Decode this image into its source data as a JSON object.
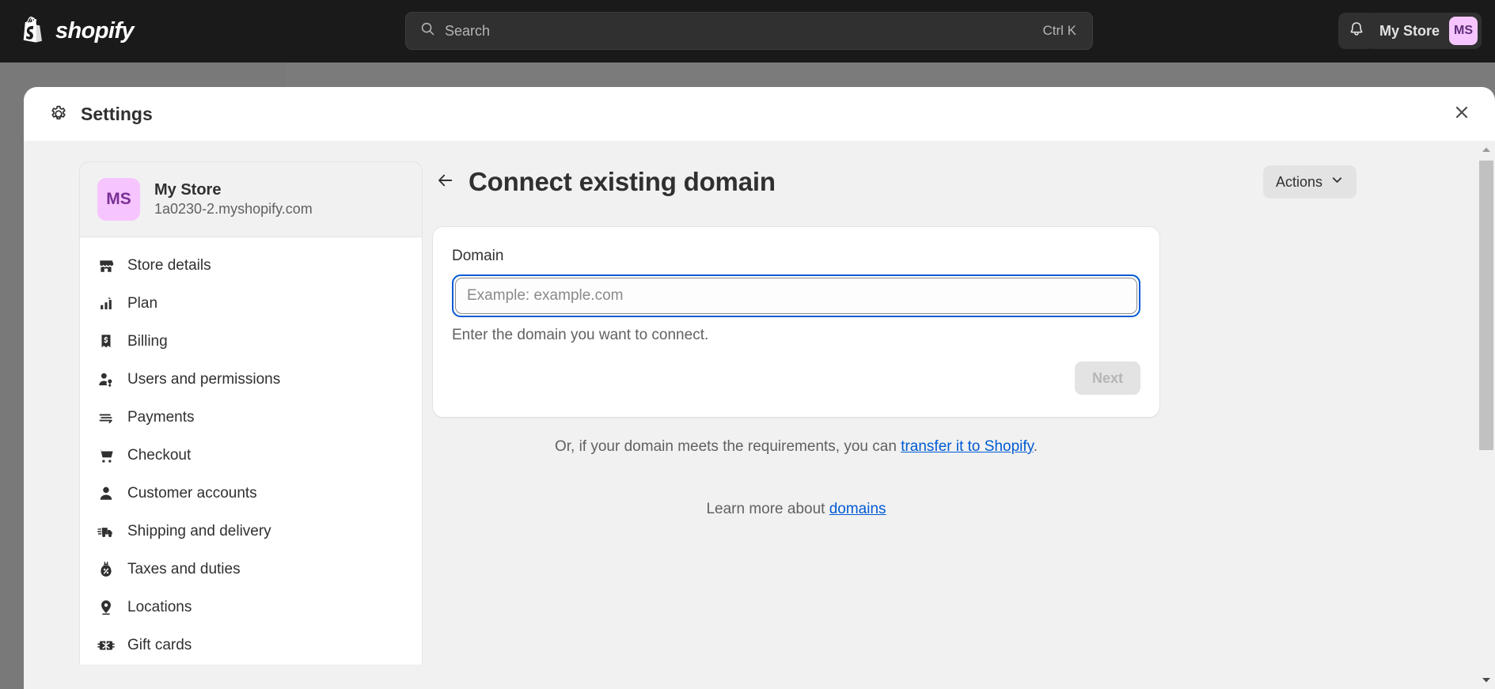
{
  "topbar": {
    "logo_text": "shopify",
    "logo_icon": "shopify-bag-icon",
    "search": {
      "icon": "search-icon",
      "placeholder": "Search",
      "value": "",
      "shortcut": "Ctrl K"
    },
    "notifications_icon": "bell-icon",
    "store_chip": {
      "name": "My Store",
      "initials": "MS",
      "avatar_color": "#f6c5ff"
    }
  },
  "modal": {
    "icon": "gear-icon",
    "title": "Settings",
    "close_icon": "close-icon"
  },
  "sidebar": {
    "store_card": {
      "initials": "MS",
      "name": "My Store",
      "url": "1a0230-2.myshopify.com"
    },
    "items": [
      {
        "label": "Store details",
        "icon": "store-icon"
      },
      {
        "label": "Plan",
        "icon": "plan-chart-icon"
      },
      {
        "label": "Billing",
        "icon": "billing-receipt-icon"
      },
      {
        "label": "Users and permissions",
        "icon": "users-key-icon"
      },
      {
        "label": "Payments",
        "icon": "payments-card-icon"
      },
      {
        "label": "Checkout",
        "icon": "cart-icon"
      },
      {
        "label": "Customer accounts",
        "icon": "person-icon"
      },
      {
        "label": "Shipping and delivery",
        "icon": "delivery-truck-icon"
      },
      {
        "label": "Taxes and duties",
        "icon": "tax-bag-percent-icon"
      },
      {
        "label": "Locations",
        "icon": "location-pin-icon"
      },
      {
        "label": "Gift cards",
        "icon": "gift-card-icon"
      }
    ]
  },
  "main": {
    "back_icon": "arrow-left-icon",
    "title": "Connect existing domain",
    "actions_button": {
      "label": "Actions",
      "icon": "chevron-down-icon"
    },
    "domain_card": {
      "field_label": "Domain",
      "input_placeholder": "Example: example.com",
      "input_value": "",
      "help_text": "Enter the domain you want to connect.",
      "next_label": "Next",
      "focus_ring_color": "#005bd3"
    },
    "transfer": {
      "prefix": "Or, if your domain meets the requirements, you can ",
      "link": "transfer it to Shopify",
      "suffix": "."
    },
    "learn_more": {
      "prefix": "Learn more about ",
      "link": "domains"
    }
  },
  "scrollbar": {
    "up_arrow_icon": "triangle-up-icon",
    "down_arrow_icon": "triangle-down-icon"
  }
}
